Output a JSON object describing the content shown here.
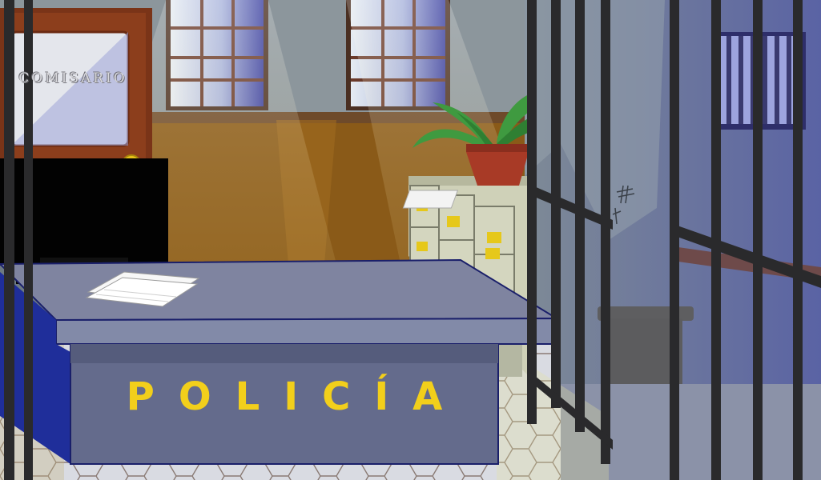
{
  "scene": {
    "door_sign": "COMISARIO",
    "desk_sign": "POLICÍA"
  },
  "colors": {
    "wall": "#8c969c",
    "wainscot": "#8a5a18",
    "desk_top": "#7f84a0",
    "desk_front": "#646b8c",
    "desk_side": "#1f2e9a",
    "sign_text": "#f2cf1b",
    "door": "#7a3418",
    "bars": "#2a2a2c"
  }
}
